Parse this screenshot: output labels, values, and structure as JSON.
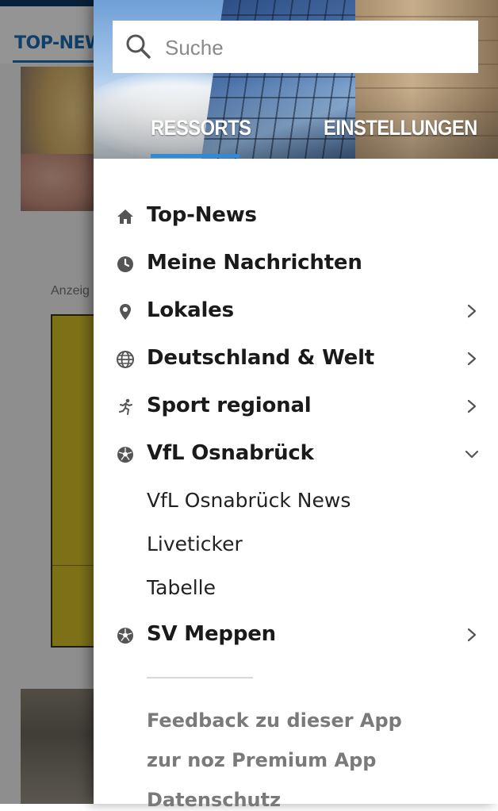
{
  "background": {
    "tab_label": "TOP-NEW",
    "ad_label": "Anzeig"
  },
  "search": {
    "placeholder": "Suche",
    "icon": "search-icon"
  },
  "tabs": [
    {
      "label": "RESSORTS",
      "active": true
    },
    {
      "label": "EINSTELLUNGEN",
      "active": false
    }
  ],
  "menu": [
    {
      "label": "Top-News",
      "icon": "home-icon",
      "chevron": "none"
    },
    {
      "label": "Meine Nachrichten",
      "icon": "clock-icon",
      "chevron": "none"
    },
    {
      "label": "Lokales",
      "icon": "map-pin-icon",
      "chevron": "right"
    },
    {
      "label": "Deutschland & Welt",
      "icon": "globe-icon",
      "chevron": "right"
    },
    {
      "label": "Sport regional",
      "icon": "runner-icon",
      "chevron": "right"
    },
    {
      "label": "VfL Osnabrück",
      "icon": "soccer-ball-icon",
      "chevron": "down",
      "children": [
        "VfL Osnabrück News",
        "Liveticker",
        "Tabelle"
      ]
    },
    {
      "label": "SV Meppen",
      "icon": "soccer-ball-icon",
      "chevron": "right"
    }
  ],
  "footer_links": [
    "Feedback zu dieser App",
    "zur noz Premium App",
    "Datenschutz"
  ],
  "colors": {
    "accent": "#2f8bd6",
    "brand_dark": "#0e3a64",
    "text": "#1a1a1a",
    "muted": "#7a7a7a"
  }
}
